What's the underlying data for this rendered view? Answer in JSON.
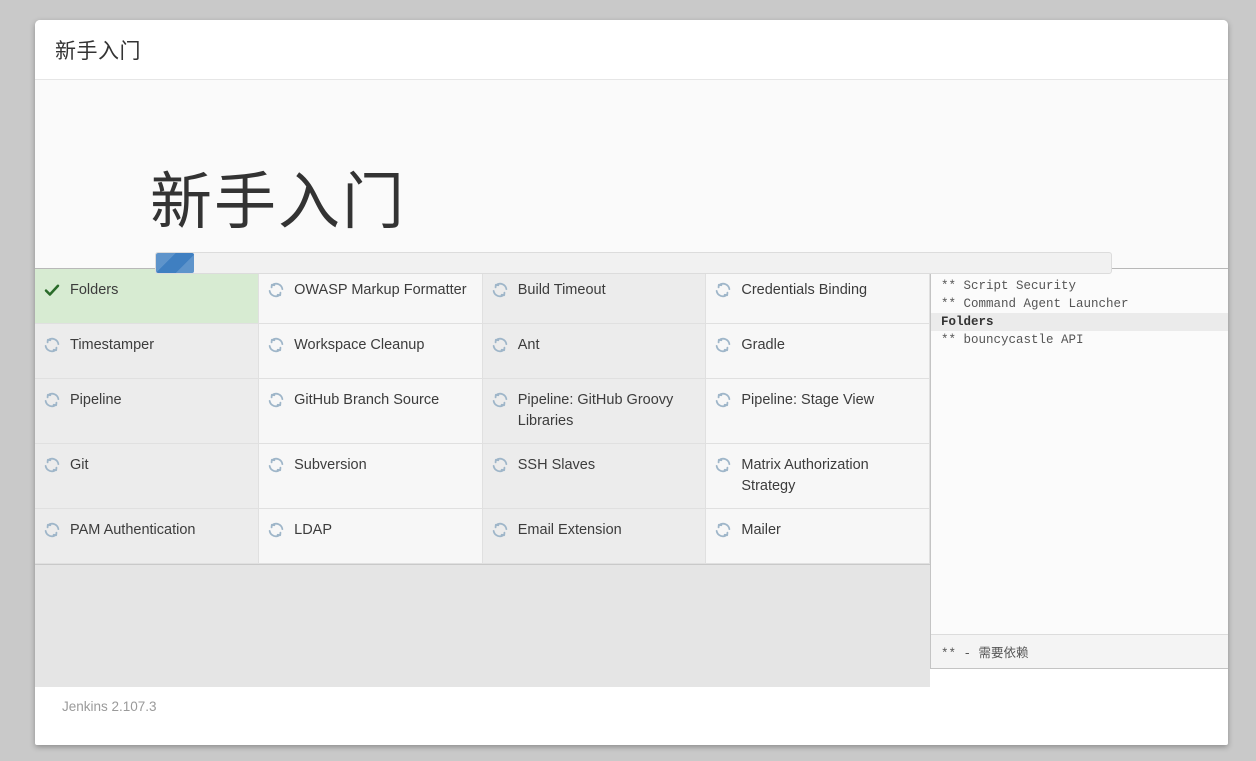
{
  "window": {
    "header_title": "新手入门"
  },
  "setup": {
    "hero_title": "新手入门",
    "progress_percent": 4,
    "accent_color": "#3f7fc1",
    "done_color": "#d7ebd2"
  },
  "plugins": {
    "icon_pending": "sync-icon",
    "icon_done": "check-icon",
    "rows": [
      [
        {
          "name": "Folders",
          "state": "done"
        },
        {
          "name": "OWASP Markup Formatter",
          "state": "pending"
        },
        {
          "name": "Build Timeout",
          "state": "pending"
        },
        {
          "name": "Credentials Binding",
          "state": "pending"
        }
      ],
      [
        {
          "name": "Timestamper",
          "state": "pending"
        },
        {
          "name": "Workspace Cleanup",
          "state": "pending"
        },
        {
          "name": "Ant",
          "state": "pending"
        },
        {
          "name": "Gradle",
          "state": "pending"
        }
      ],
      [
        {
          "name": "Pipeline",
          "state": "pending"
        },
        {
          "name": "GitHub Branch Source",
          "state": "pending"
        },
        {
          "name": "Pipeline: GitHub Groovy Libraries",
          "state": "pending"
        },
        {
          "name": "Pipeline: Stage View",
          "state": "pending"
        }
      ],
      [
        {
          "name": "Git",
          "state": "pending"
        },
        {
          "name": "Subversion",
          "state": "pending"
        },
        {
          "name": "SSH Slaves",
          "state": "pending"
        },
        {
          "name": "Matrix Authorization Strategy",
          "state": "pending"
        }
      ],
      [
        {
          "name": "PAM Authentication",
          "state": "pending"
        },
        {
          "name": "LDAP",
          "state": "pending"
        },
        {
          "name": "Email Extension",
          "state": "pending"
        },
        {
          "name": "Mailer",
          "state": "pending"
        }
      ]
    ]
  },
  "install_log": {
    "lines": [
      {
        "text": "** Script Security",
        "active": false
      },
      {
        "text": "** Command Agent Launcher",
        "active": false
      },
      {
        "text": "Folders",
        "active": true
      },
      {
        "text": "** bouncycastle API",
        "active": false
      }
    ],
    "legend": "** - 需要依赖"
  },
  "footer": {
    "version": "Jenkins 2.107.3"
  }
}
